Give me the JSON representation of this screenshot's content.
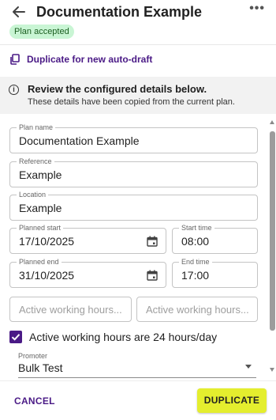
{
  "header": {
    "title": "Documentation Example",
    "back_icon": "arrow-left-icon",
    "more_icon": "more-horizontal-icon",
    "more_glyph": "•••",
    "status_badge": "Plan accepted"
  },
  "duplicate_link": {
    "label": "Duplicate for new auto-draft",
    "icon": "copy-icon"
  },
  "info_banner": {
    "icon": "info-icon",
    "title": "Review the configured details below.",
    "subtitle": "These details have been copied from the current plan."
  },
  "form": {
    "plan_name": {
      "label": "Plan name",
      "value": "Documentation Example"
    },
    "reference": {
      "label": "Reference",
      "value": "Example"
    },
    "location": {
      "label": "Location",
      "value": "Example"
    },
    "planned_start": {
      "label": "Planned start",
      "value": "17/10/2025"
    },
    "start_time": {
      "label": "Start time",
      "value": "08:00"
    },
    "planned_end": {
      "label": "Planned end",
      "value": "31/10/2025"
    },
    "end_time": {
      "label": "End time",
      "value": "17:00"
    },
    "active_hours_start": {
      "placeholder": "Active working hours..."
    },
    "active_hours_end": {
      "placeholder": "Active working hours..."
    },
    "all_day_checkbox": {
      "label": "Active working hours are 24 hours/day",
      "checked": true
    },
    "promoter": {
      "label": "Promoter",
      "value": "Bulk Test"
    }
  },
  "footer": {
    "cancel_label": "CANCEL",
    "duplicate_label": "DUPLICATE"
  },
  "colors": {
    "accent": "#4a1a86",
    "primary_button": "#e4ee2e",
    "badge_bg": "#c9f5d4",
    "banner_bg": "#f2f2f2"
  }
}
